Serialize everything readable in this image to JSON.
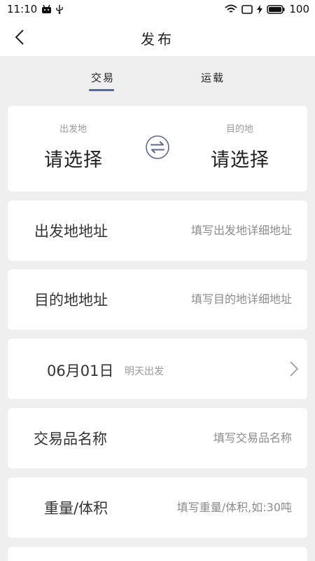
{
  "status_bar": {
    "time": "11:10",
    "battery": "100"
  },
  "header": {
    "title": "发布"
  },
  "tabs": [
    {
      "label": "交易"
    },
    {
      "label": "运载"
    }
  ],
  "route": {
    "from_label": "出发地",
    "from_value": "请选择",
    "to_label": "目的地",
    "to_value": "请选择"
  },
  "form": {
    "origin_address": {
      "label": "出发地地址",
      "placeholder": "填写出发地详细地址"
    },
    "dest_address": {
      "label": "目的地地址",
      "placeholder": "填写目的地详细地址"
    },
    "date": {
      "value": "06月01日",
      "sub": "明天出发"
    },
    "goods_name": {
      "label": "交易品名称",
      "placeholder": "填写交易品名称"
    },
    "weight": {
      "label": "重量/体积",
      "placeholder": "填写重量/体积,如:30吨"
    }
  },
  "colors": {
    "accent": "#5a6894",
    "background": "#efefef"
  }
}
